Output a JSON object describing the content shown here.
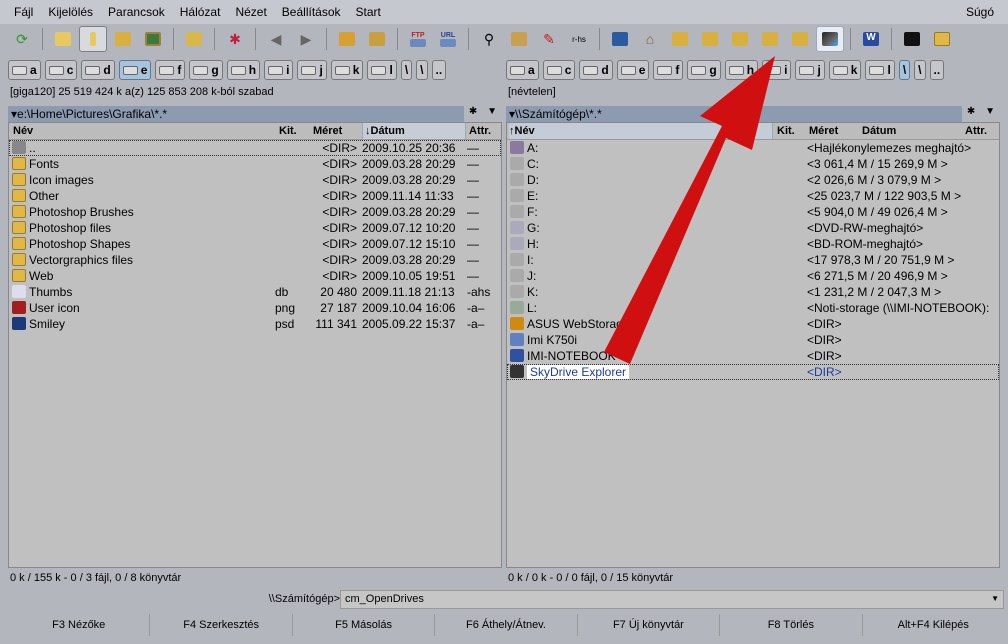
{
  "menu": [
    "Fájl",
    "Kijelölés",
    "Parancsok",
    "Hálózat",
    "Nézet",
    "Beállítások",
    "Start"
  ],
  "menu_help": "Súgó",
  "toolbar": {
    "ftp_label": "FTP",
    "url_label": "URL",
    "rhs_label": "r-hs"
  },
  "drives_left": [
    "a",
    "c",
    "d",
    "e",
    "f",
    "g",
    "h",
    "i",
    "j",
    "k",
    "l",
    "\\",
    "\\",
    ".."
  ],
  "drives_right": [
    "a",
    "c",
    "d",
    "e",
    "f",
    "g",
    "h",
    "i",
    "j",
    "k",
    "l",
    "\\",
    "\\",
    ".."
  ],
  "left": {
    "info": "[giga120]  25 519 424 k a(z) 125 853 208 k-ból szabad",
    "path": "e:\\Home\\Pictures\\Grafika\\*.*",
    "cols": {
      "name": "Név",
      "ext": "Kit.",
      "size": "Méret",
      "date": "↓Dátum",
      "attr": "Attr."
    },
    "rows": [
      {
        "name": "..",
        "ext": "",
        "size": "<DIR>",
        "date": "2009.10.25 20:36",
        "attr": "—",
        "icon": "up"
      },
      {
        "name": "Fonts",
        "ext": "",
        "size": "<DIR>",
        "date": "2009.03.28 20:29",
        "attr": "—",
        "icon": "folder"
      },
      {
        "name": "Icon images",
        "ext": "",
        "size": "<DIR>",
        "date": "2009.03.28 20:29",
        "attr": "—",
        "icon": "folder"
      },
      {
        "name": "Other",
        "ext": "",
        "size": "<DIR>",
        "date": "2009.11.14 11:33",
        "attr": "—",
        "icon": "folder"
      },
      {
        "name": "Photoshop Brushes",
        "ext": "",
        "size": "<DIR>",
        "date": "2009.03.28 20:29",
        "attr": "—",
        "icon": "folder"
      },
      {
        "name": "Photoshop files",
        "ext": "",
        "size": "<DIR>",
        "date": "2009.07.12 10:20",
        "attr": "—",
        "icon": "folder"
      },
      {
        "name": "Photoshop Shapes",
        "ext": "",
        "size": "<DIR>",
        "date": "2009.07.12 15:10",
        "attr": "—",
        "icon": "folder"
      },
      {
        "name": "Vectorgraphics files",
        "ext": "",
        "size": "<DIR>",
        "date": "2009.03.28 20:29",
        "attr": "—",
        "icon": "folder"
      },
      {
        "name": "Web",
        "ext": "",
        "size": "<DIR>",
        "date": "2009.10.05 19:51",
        "attr": "—",
        "icon": "folder"
      },
      {
        "name": "Thumbs",
        "ext": "db",
        "size": "20 480",
        "date": "2009.11.18 21:13",
        "attr": "-ahs",
        "icon": "file-warning"
      },
      {
        "name": "User icon",
        "ext": "png",
        "size": "27 187",
        "date": "2009.10.04 16:06",
        "attr": "-a–",
        "icon": "png"
      },
      {
        "name": "Smiley",
        "ext": "psd",
        "size": "111 341",
        "date": "2005.09.22 15:37",
        "attr": "-a–",
        "icon": "psd"
      }
    ],
    "status": "0 k / 155 k - 0 / 3 fájl, 0 / 8 könyvtár"
  },
  "right": {
    "info": "[névtelen]",
    "path": "\\\\Számítógép\\*.*",
    "cols": {
      "name": "↑Név",
      "ext": "Kit.",
      "size": "Méret",
      "date": "Dátum",
      "attr": "Attr."
    },
    "rows": [
      {
        "name": "A:",
        "size": "<Hajlékonylemezes meghajtó>",
        "icon": "floppy"
      },
      {
        "name": "C:",
        "size": "<3 061,4 M / 15 269,9 M >",
        "icon": "drive"
      },
      {
        "name": "D:",
        "size": "<2 026,6 M / 3 079,9 M >",
        "icon": "drive"
      },
      {
        "name": "E:",
        "size": "<25 023,7 M / 122 903,5 M >",
        "icon": "drive"
      },
      {
        "name": "F:",
        "size": "<5 904,0 M / 49 026,4 M >",
        "icon": "drive"
      },
      {
        "name": "G:",
        "size": "<DVD-RW-meghajtó>",
        "icon": "cd"
      },
      {
        "name": "H:",
        "size": "<BD-ROM-meghajtó>",
        "icon": "cd"
      },
      {
        "name": "I:",
        "size": "<17 978,3 M / 20 751,9 M >",
        "icon": "drive"
      },
      {
        "name": "J:",
        "size": "<6 271,5 M / 20 496,9 M >",
        "icon": "drive"
      },
      {
        "name": "K:",
        "size": "<1 231,2 M / 2 047,3 M >",
        "icon": "drive"
      },
      {
        "name": "L:",
        "size": "<Noti-storage (\\\\IMI-NOTEBOOK):",
        "icon": "network"
      },
      {
        "name": "ASUS WebStorage",
        "size": "<DIR>",
        "icon": "webstorage"
      },
      {
        "name": "Imi K750i",
        "size": "<DIR>",
        "icon": "phone"
      },
      {
        "name": "IMI-NOTEBOOK",
        "size": "<DIR>",
        "icon": "computer"
      },
      {
        "name": "SkyDrive Explorer",
        "size": "<DIR>",
        "icon": "skydrive",
        "focused": true
      }
    ],
    "status": "0 k / 0 k - 0 / 0 fájl, 0 / 15 könyvtár"
  },
  "cmd": {
    "prompt": "\\\\Számítógép>",
    "value": "cm_OpenDrives"
  },
  "fkeys": [
    "F3 Nézőke",
    "F4 Szerkesztés",
    "F5 Másolás",
    "F6 Áthely/Átnev.",
    "F7 Új könyvtár",
    "F8 Törlés",
    "Alt+F4 Kilépés"
  ],
  "colors": {
    "arrow": "#d01010",
    "path_bar": "#8d9bb0",
    "list_bg": "#c0c0c0",
    "selected_text": "#1a3c9c"
  }
}
